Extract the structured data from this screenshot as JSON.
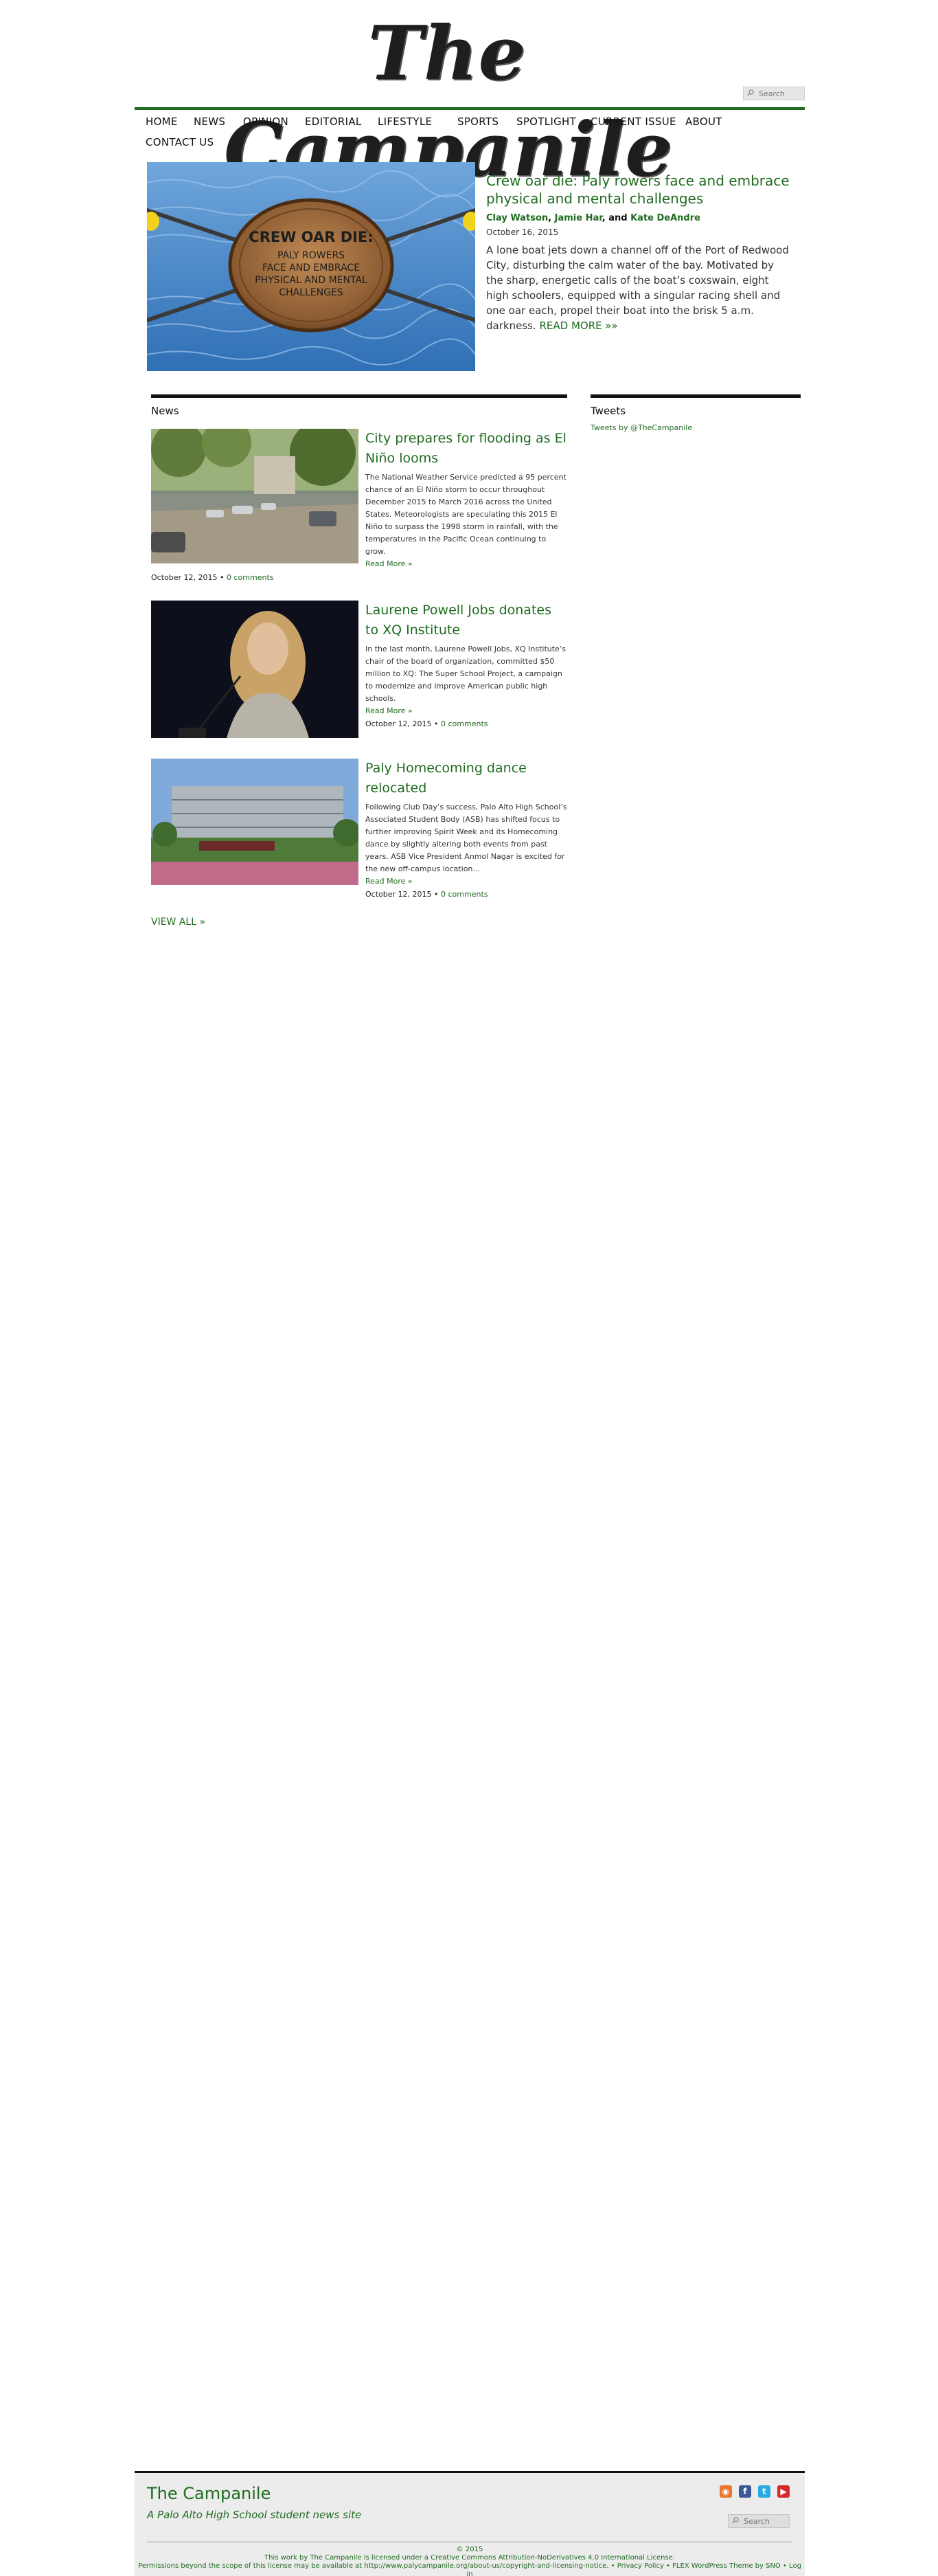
{
  "site": {
    "name": "The Campanile",
    "search_placeholder": "Search"
  },
  "nav": {
    "items": [
      {
        "label": "HOME"
      },
      {
        "label": "NEWS"
      },
      {
        "label": "OPINION"
      },
      {
        "label": "EDITORIAL"
      },
      {
        "label": "LIFESTYLE"
      },
      {
        "label": "SPORTS"
      },
      {
        "label": "SPOTLIGHT"
      },
      {
        "label": "CURRENT ISSUE"
      },
      {
        "label": "ABOUT"
      },
      {
        "label": "CONTACT US"
      }
    ]
  },
  "featured": {
    "image_sign_lines": [
      "CREW OAR DIE:",
      "PALY ROWERS",
      "FACE AND EMBRACE",
      "PHYSICAL AND MENTAL",
      "CHALLENGES"
    ],
    "title": "Crew oar die: Paly rowers face and embrace physical and mental challenges",
    "authors": [
      "Clay Watson",
      "Jamie Har",
      "Kate DeAndre"
    ],
    "author_sep1": ",",
    "author_sep2": ", and",
    "date": "October 16, 2015",
    "excerpt": "A lone boat jets down a channel off of the Port of Redwood City, disturbing the calm water of the bay. Motivated by the sharp, energetic calls of the boat’s coxswain, eight high schoolers, equipped with a singular racing shell and one oar each, propel their boat into the brisk 5 a.m. darkness.",
    "read_more": "READ MORE »»"
  },
  "news": {
    "heading": "News",
    "stories": [
      {
        "title": "City prepares for flooding as El Niño looms",
        "excerpt": "The National Weather Service predicted a 95 percent chance of an El Niño storm to occur throughout December 2015 to March 2016 across the United States. Meteorologists are speculating this 2015 El Niño to surpass the 1998 storm in rainfall, with the temperatures in the Pacific Ocean continuing to grow.",
        "read_more": "Read More »",
        "date": "October 12, 2015",
        "bullet": "•",
        "comments": "0 comments"
      },
      {
        "title": "Laurene Powell Jobs donates to XQ Institute",
        "excerpt": "In the last month, Laurene Powell Jobs, XQ Institute’s chair of the board of organization, committed $50 million to XQ: The Super School Project, a campaign to modernize and improve American public high schools.",
        "read_more": "Read More »",
        "date": "October 12, 2015",
        "bullet": "•",
        "comments": "0 comments"
      },
      {
        "title": "Paly Homecoming dance relocated",
        "excerpt": "Following Club Day’s success, Palo Alto High School’s Associated Student Body (ASB) has shifted focus to further improving Spirit Week and its Homecoming dance by slightly altering both events from past years. ASB Vice President Anmol Nagar is excited for the new off-campus location...",
        "read_more": "Read More »",
        "date": "October 12, 2015",
        "bullet": "•",
        "comments": "0 comments"
      }
    ],
    "view_all": "VIEW ALL »"
  },
  "tweets": {
    "heading": "Tweets",
    "link": "Tweets by @TheCampanile"
  },
  "footer": {
    "title": "The Campanile",
    "subtitle": "A Palo Alto High School student news site",
    "search_placeholder": "Search",
    "copyright": "© 2015",
    "license_line": "This work by The Campanile is licensed under a Creative Commons Attribution-NoDerivatives 4.0 International License.",
    "permissions_line": "Permissions beyond the scope of this license may be available at http://www.palycampanile.org/about-us/copyright-and-licensing-notice. • Privacy Policy • FLEX WordPress Theme by SNO • Log in",
    "social_icons": [
      "rss-icon",
      "facebook-icon",
      "twitter-icon",
      "youtube-icon"
    ],
    "social_colors": [
      "#e8762b",
      "#3b5998",
      "#2aa9e0",
      "#d62a2a"
    ]
  },
  "colors": {
    "accent": "#1f6b1f",
    "rule": "#111111",
    "footer_bg": "#ececec"
  }
}
